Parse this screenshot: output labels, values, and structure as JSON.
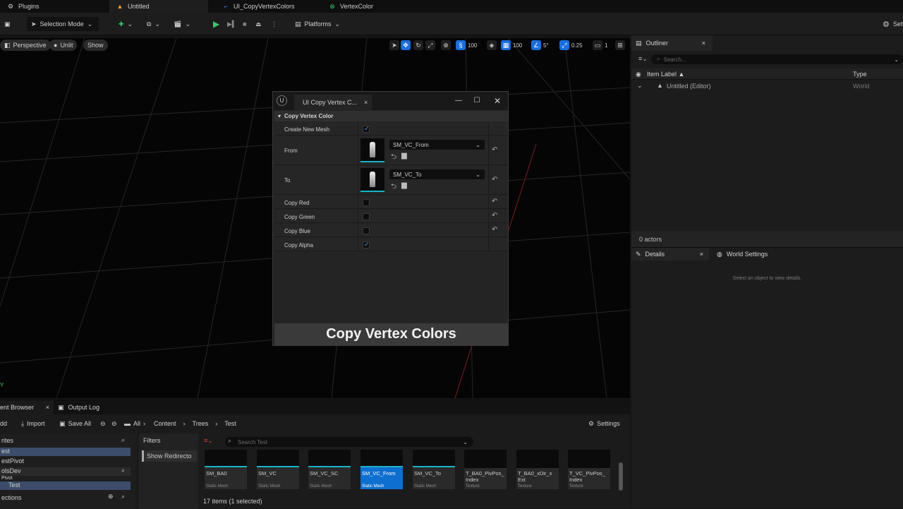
{
  "top_tabs": [
    {
      "label": "Plugins"
    },
    {
      "label": "Untitled"
    },
    {
      "label": "UI_CopyVertexColors"
    },
    {
      "label": "VertexColor"
    }
  ],
  "toolbar": {
    "selection_mode": "Selection Mode",
    "platforms": "Platforms",
    "settings": "Setti"
  },
  "viewport": {
    "perspective": "Perspective",
    "unlit": "Unlit",
    "show": "Show",
    "translate_snap": "100",
    "grid_snap": "100",
    "rotation_snap": "5°",
    "scale_snap": "0.25",
    "camera_speed": "1",
    "axis_label": "Y"
  },
  "floating_window": {
    "tab_label": "UI Copy Vertex C...",
    "section": "Copy Vertex Color",
    "properties": [
      {
        "label": "Create New Mesh",
        "type": "checkbox",
        "checked": true
      },
      {
        "label": "From",
        "type": "asset",
        "value": "SM_VC_From"
      },
      {
        "label": "To",
        "type": "asset",
        "value": "SM_VC_To"
      },
      {
        "label": "Copy Red",
        "type": "checkbox",
        "checked": false
      },
      {
        "label": "Copy Green",
        "type": "checkbox",
        "checked": false
      },
      {
        "label": "Copy Blue",
        "type": "checkbox",
        "checked": false
      },
      {
        "label": "Copy Alpha",
        "type": "checkbox",
        "checked": true
      }
    ],
    "button_label": "Copy Vertex Colors"
  },
  "outliner": {
    "tab_label": "Outliner",
    "search_placeholder": "Search...",
    "col_label": "Item Label ▲",
    "col_type": "Type",
    "row_label": "Untitled (Editor)",
    "row_type": "World",
    "footer": "0 actors"
  },
  "details": {
    "tab_details": "Details",
    "tab_world_settings": "World Settings",
    "empty_text": "Select an object to view details."
  },
  "content_browser": {
    "tab_label": "ent Browser",
    "tab_output_log": "Output Log",
    "add": "dd",
    "import": "Import",
    "save_all": "Save All",
    "breadcrumb": [
      "All",
      "Content",
      "Trees",
      "Test"
    ],
    "settings": "Settings",
    "favorites": "rites",
    "tree": [
      "est",
      "estPivot",
      "olsDev",
      "Pivot",
      "Test"
    ],
    "collections": "ections",
    "filters_label": "Filters",
    "show_redirectors": "Show Redirecto",
    "search_placeholder": "Search Test",
    "status": "17 items (1 selected)",
    "assets": [
      {
        "name": "SM_BA0",
        "kind": "Static Mesh"
      },
      {
        "name": "SM_VC",
        "kind": "Static Mesh"
      },
      {
        "name": "SM_VC_SC",
        "kind": "Static Mesh"
      },
      {
        "name": "SM_VC_From",
        "kind": "Static Mesh"
      },
      {
        "name": "SM_VC_To",
        "kind": "Static Mesh"
      },
      {
        "name": "T_BA0_PivPos_ Index",
        "kind": "Texture"
      },
      {
        "name": "T_BA0_xDir_x Ext",
        "kind": "Texture"
      },
      {
        "name": "T_VC_PivPos_ Index",
        "kind": "Texture"
      }
    ]
  }
}
